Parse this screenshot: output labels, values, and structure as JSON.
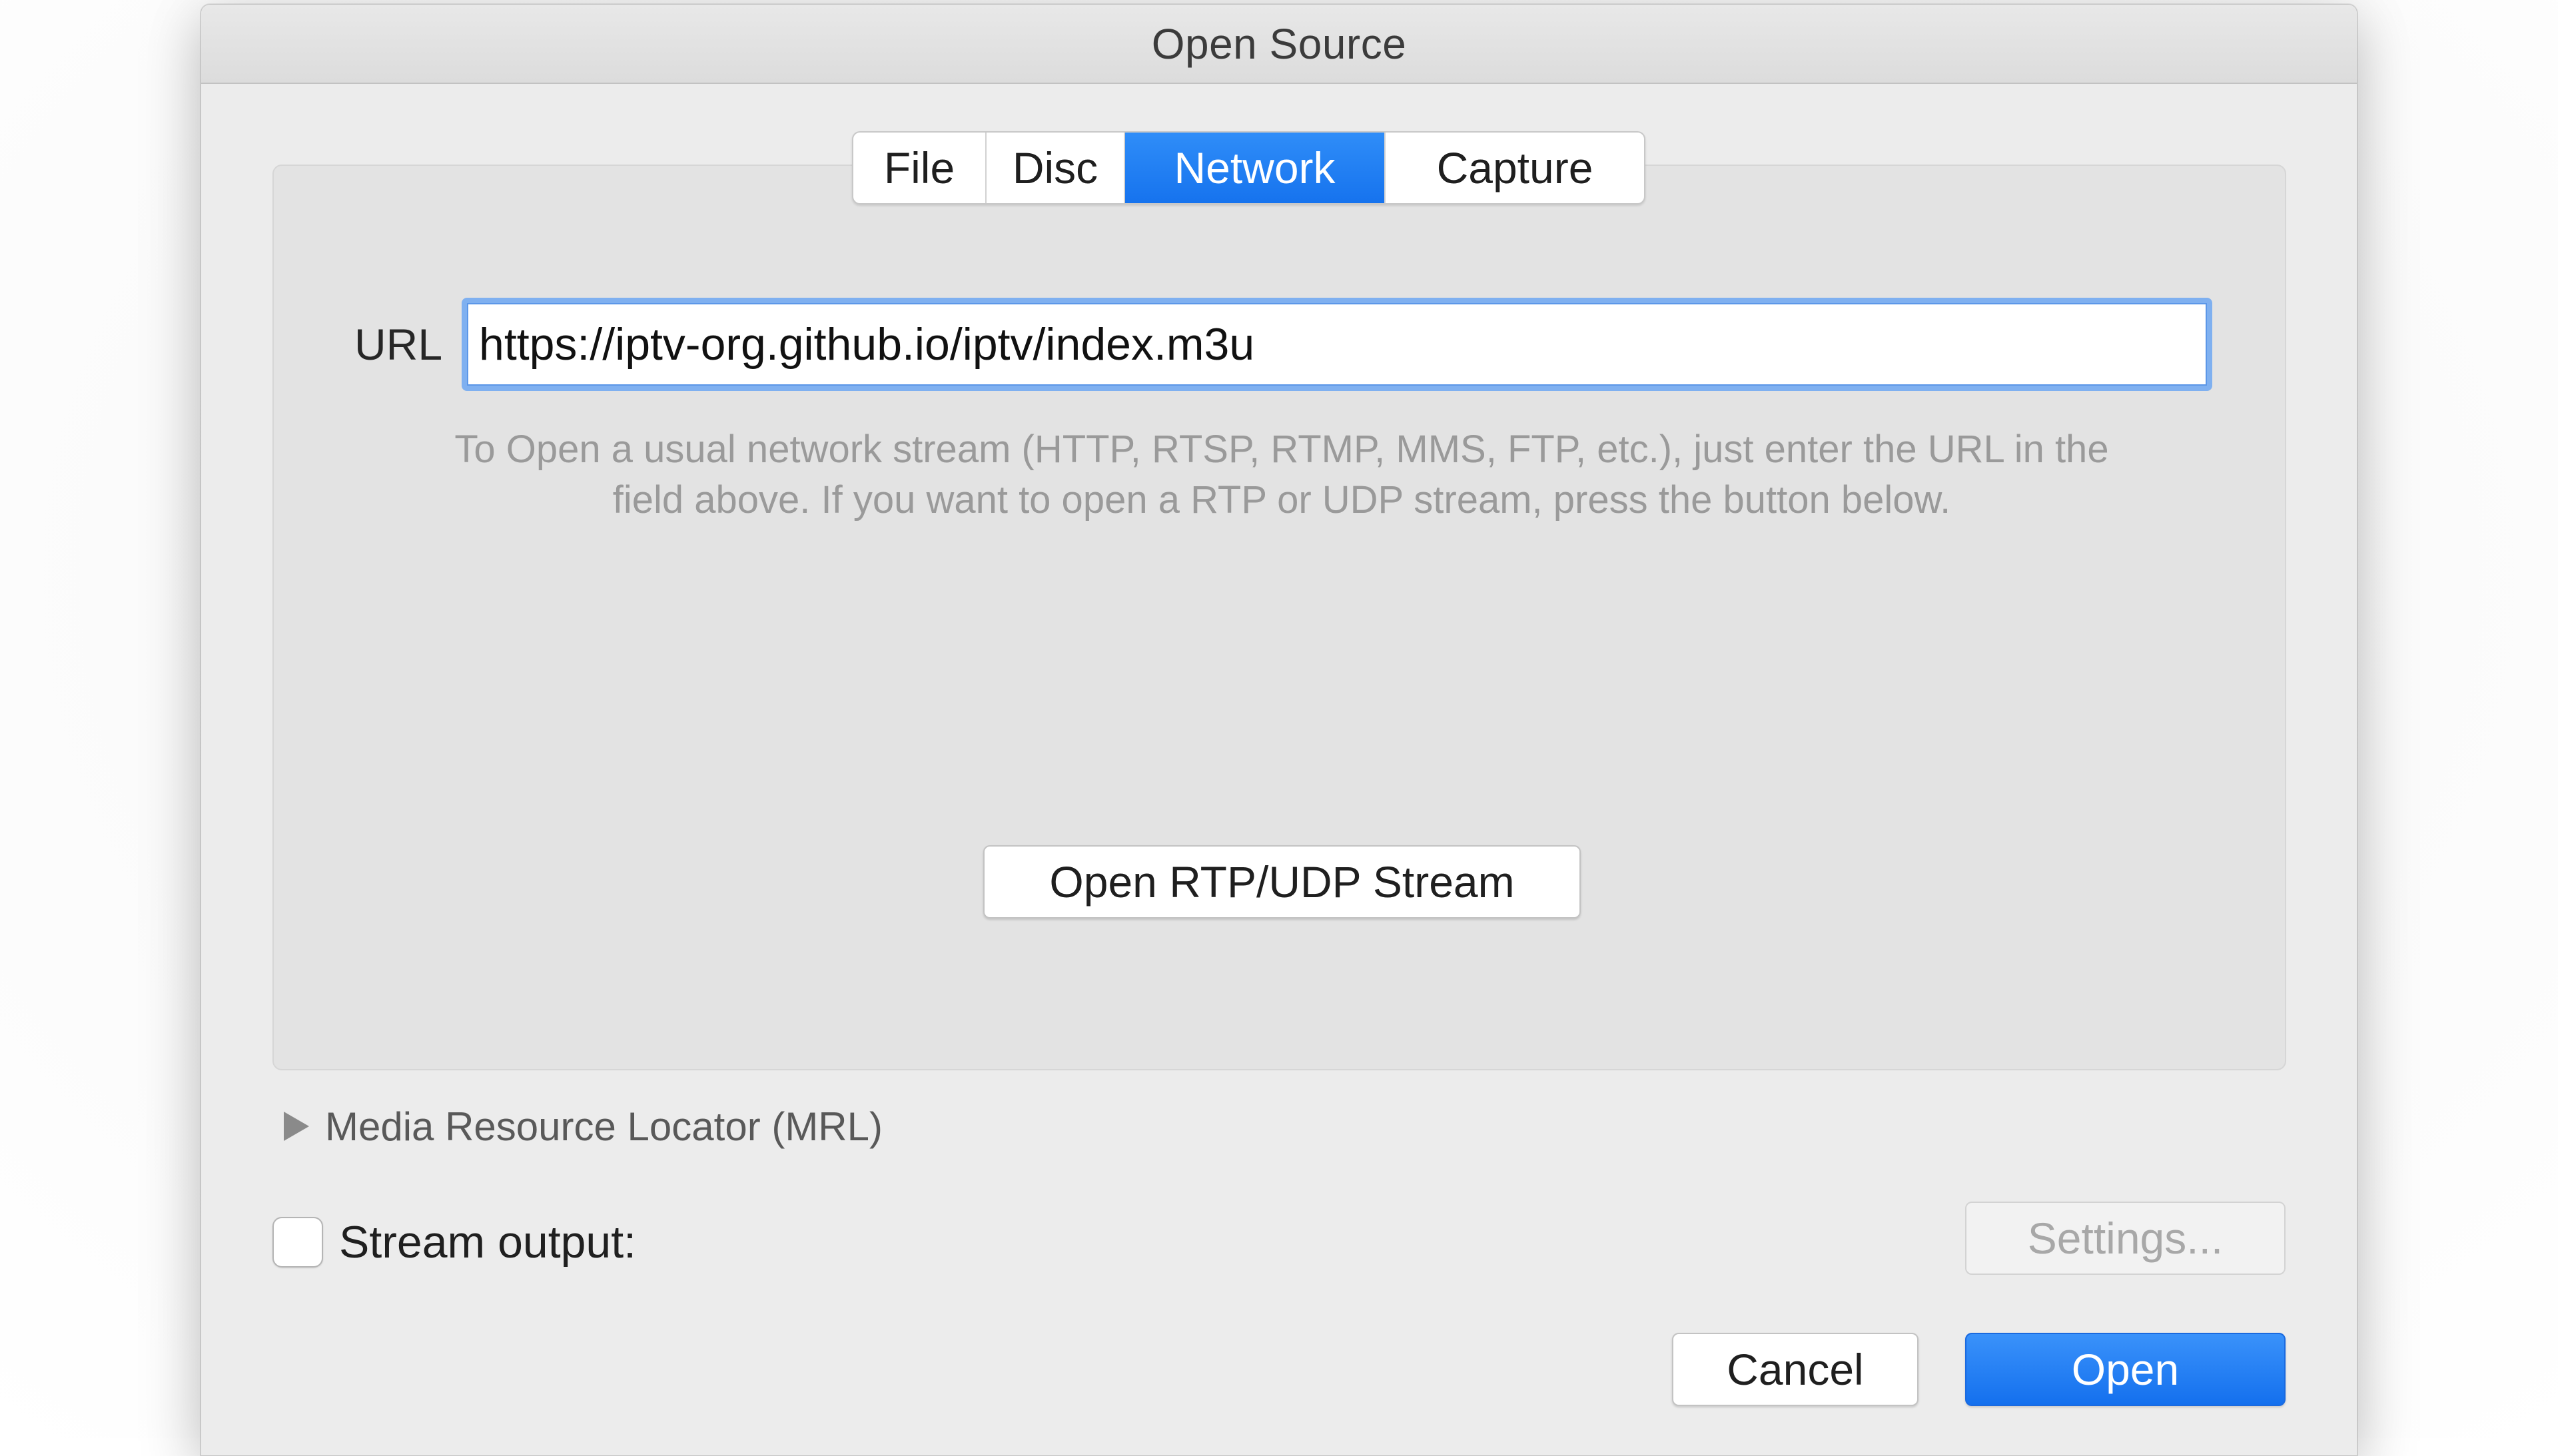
{
  "window": {
    "title": "Open Source"
  },
  "tabs": [
    {
      "label": "File",
      "active": false
    },
    {
      "label": "Disc",
      "active": false
    },
    {
      "label": "Network",
      "active": true
    },
    {
      "label": "Capture",
      "active": false
    }
  ],
  "network": {
    "url_label": "URL",
    "url_value": "https://iptv-org.github.io/iptv/index.m3u",
    "help_line_1": "To Open a usual network stream (HTTP, RTSP, RTMP, MMS, FTP, etc.), just enter the URL in the",
    "help_line_2": "field above. If you want to open a RTP or UDP stream, press the button below.",
    "rtp_button_label": "Open RTP/UDP Stream"
  },
  "mrl": {
    "label": "Media Resource Locator (MRL)",
    "icon": "disclosure-triangle-right-icon"
  },
  "stream_output": {
    "label": "Stream output:",
    "checked": false,
    "settings_label": "Settings..."
  },
  "footer": {
    "cancel_label": "Cancel",
    "open_label": "Open"
  },
  "colors": {
    "accent": "#1673ee",
    "focus_ring": "#7fb0f0",
    "help_text": "#9a9a9a"
  }
}
